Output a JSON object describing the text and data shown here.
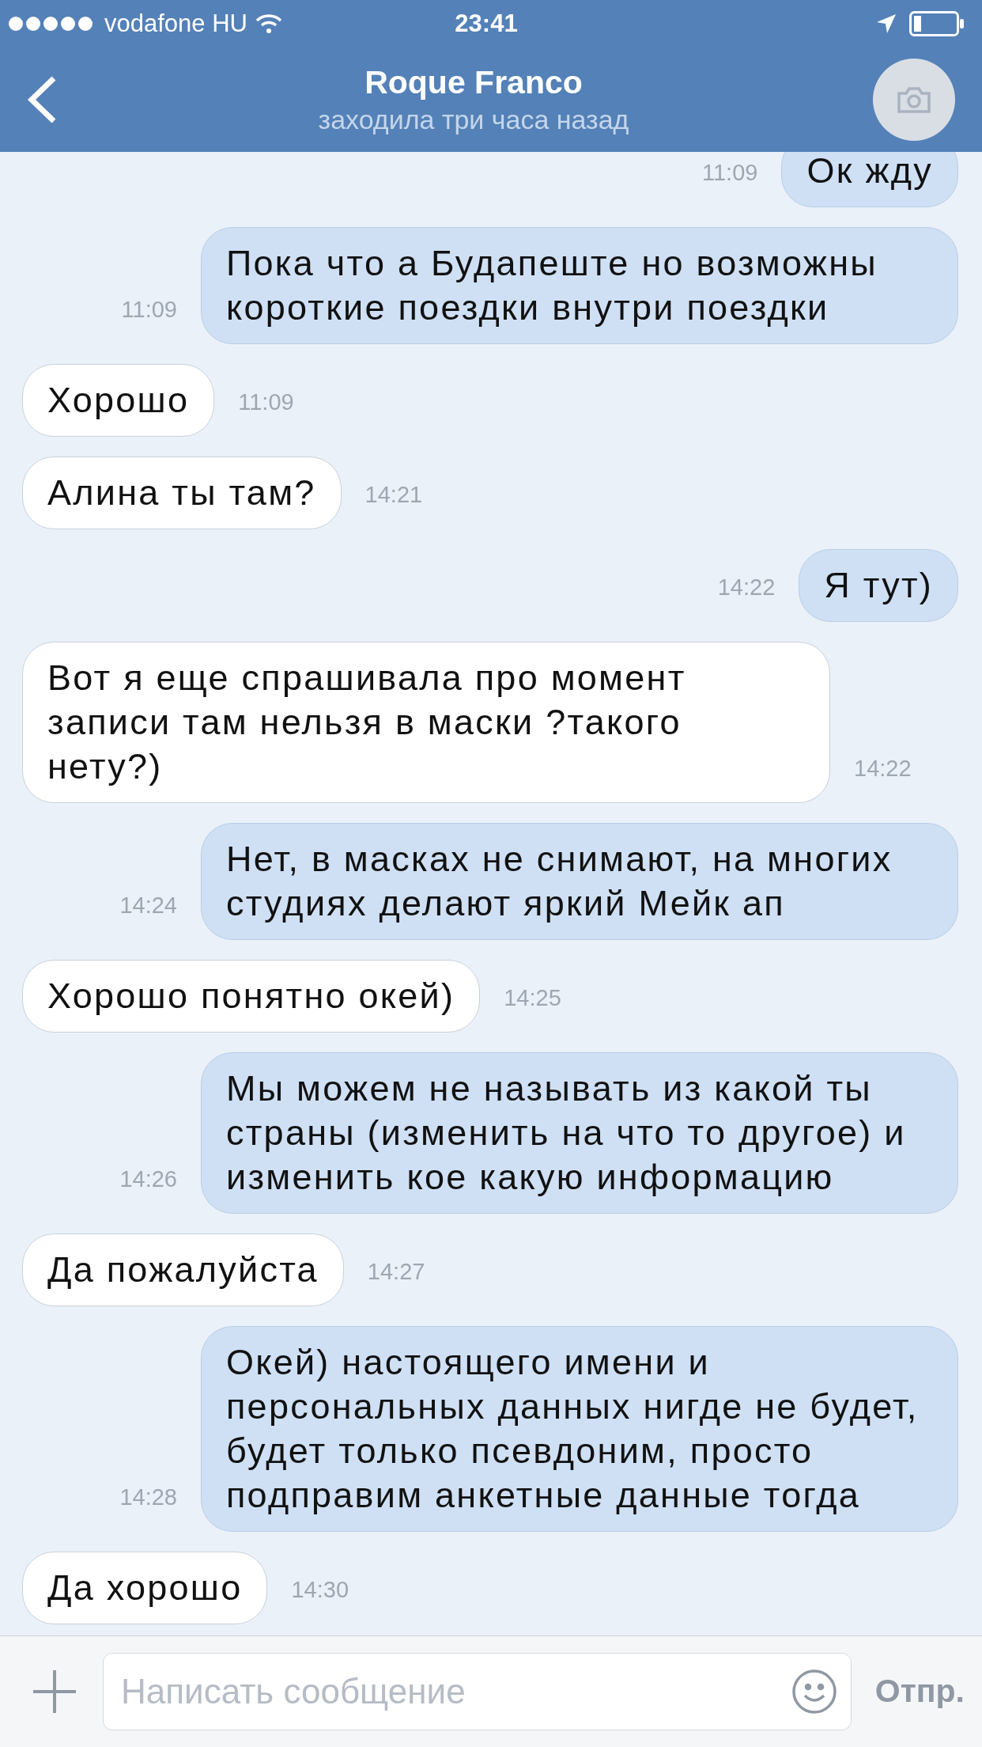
{
  "status_bar": {
    "carrier": "vodafone HU",
    "time": "23:41"
  },
  "header": {
    "title": "Roque Franco",
    "subtitle": "заходила три часа назад"
  },
  "messages": [
    {
      "kind": "outgoing",
      "text": "Ок жду",
      "time": "11:09"
    },
    {
      "kind": "outgoing",
      "text": "Пока что а Будапеште но возможны короткие поездки внутри поездки",
      "time": "11:09"
    },
    {
      "kind": "incoming",
      "text": "Хорошо",
      "time": "11:09"
    },
    {
      "kind": "incoming",
      "text": "Алина ты там?",
      "time": "14:21"
    },
    {
      "kind": "outgoing",
      "text": "Я тут)",
      "time": "14:22"
    },
    {
      "kind": "incoming",
      "text": "Вот я еще спрашивала про момент записи там нельзя в маски ?такого нету?)",
      "time": "14:22"
    },
    {
      "kind": "outgoing",
      "text": "Нет, в масках не снимают, на многих студиях делают яркий Мейк ап",
      "time": "14:24"
    },
    {
      "kind": "incoming",
      "text": "Хорошо понятно окей)",
      "time": "14:25"
    },
    {
      "kind": "outgoing",
      "text": "Мы можем не называть из какой ты страны (изменить на что то другое) и изменить кое какую информацию",
      "time": "14:26"
    },
    {
      "kind": "incoming",
      "text": "Да пожалуйста",
      "time": "14:27"
    },
    {
      "kind": "outgoing",
      "text": "Окей) настоящего имени и персональных данных нигде не будет, будет только псевдоним, просто подправим анкетные данные тогда",
      "time": "14:28"
    },
    {
      "kind": "incoming",
      "text": "Да хорошо",
      "time": "14:30"
    }
  ],
  "composer": {
    "placeholder": "Написать сообщение",
    "send_label": "Отпр."
  }
}
